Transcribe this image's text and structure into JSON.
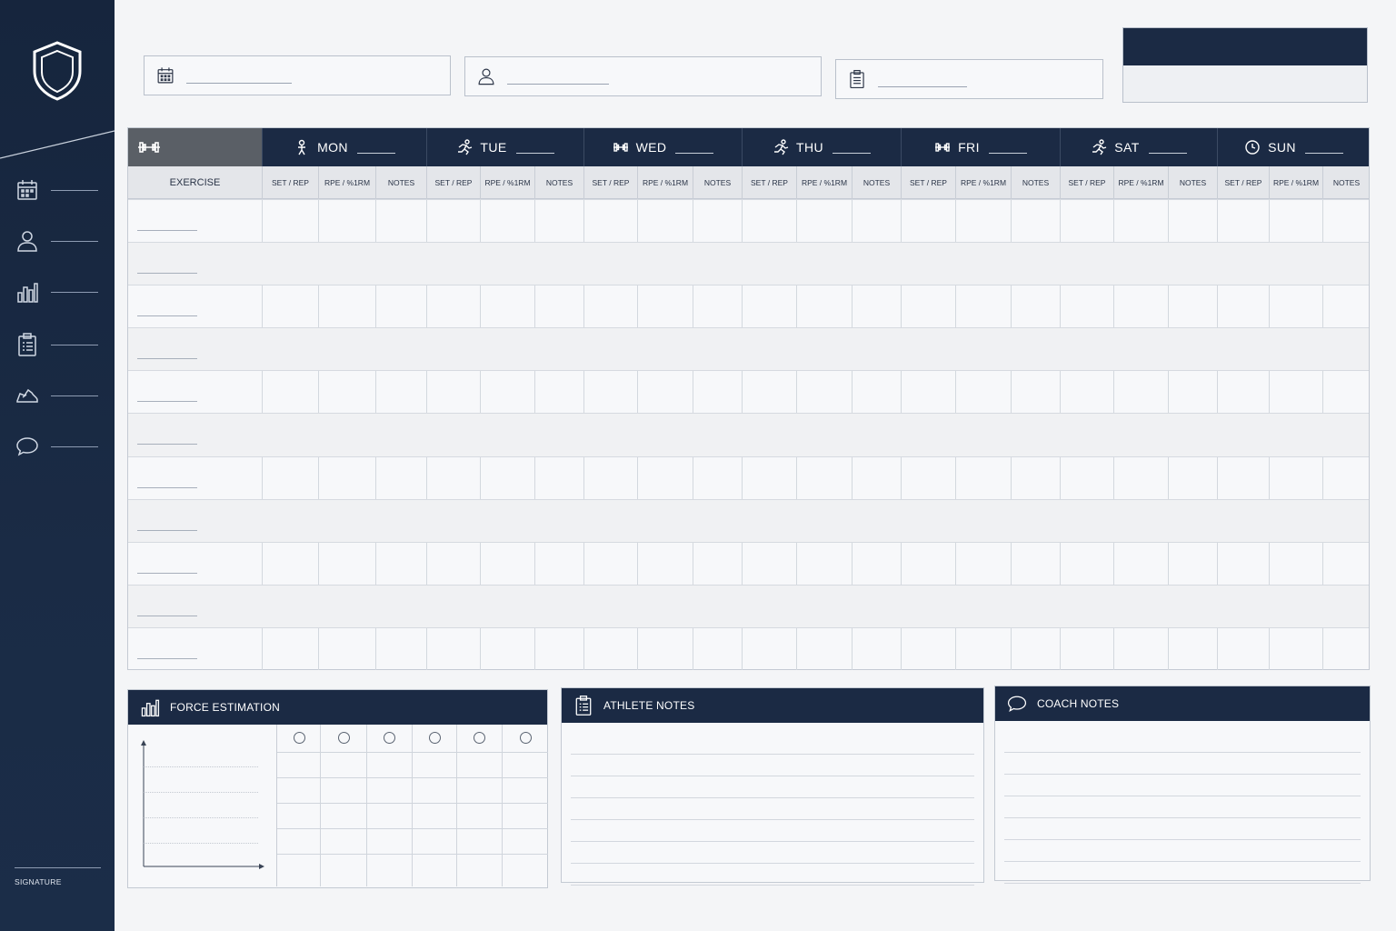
{
  "sidebar": {
    "logo_icon": "shield-icon",
    "items": [
      {
        "icon": "calendar-icon"
      },
      {
        "icon": "user-icon"
      },
      {
        "icon": "bar-chart-icon"
      },
      {
        "icon": "clipboard-icon"
      },
      {
        "icon": "sneaker-icon"
      },
      {
        "icon": "chat-bubble-icon"
      }
    ],
    "signature_label": "SIGNATURE"
  },
  "top_fields": [
    {
      "icon": "calendar-icon"
    },
    {
      "icon": "user-icon"
    },
    {
      "icon": "clipboard-icon"
    }
  ],
  "table": {
    "first_header_icon": "dumbbell-icon",
    "exercise_label": "EXERCISE",
    "days": [
      {
        "label": "MON",
        "icon": "figure-icon"
      },
      {
        "label": "TUE",
        "icon": "runner-icon"
      },
      {
        "label": "WED",
        "icon": "dumbbell-icon"
      },
      {
        "label": "THU",
        "icon": "runner-icon"
      },
      {
        "label": "FRI",
        "icon": "dumbbell-icon"
      },
      {
        "label": "SAT",
        "icon": "runner-icon"
      },
      {
        "label": "SUN",
        "icon": "clock-icon"
      }
    ],
    "sub_headers": [
      "SET / REP",
      "RPE / %1RM",
      "NOTES"
    ],
    "row_count": 11
  },
  "panels": {
    "force": {
      "title": "FORCE ESTIMATION",
      "icon": "bar-chart-icon"
    },
    "athlete": {
      "title": "ATHLETE NOTES",
      "icon": "clipboard-icon"
    },
    "coach": {
      "title": "COACH NOTES",
      "icon": "chat-bubble-icon"
    }
  },
  "colors": {
    "navy": "#1b2a44",
    "header_gray": "#5a5f66",
    "paper": "#f7f8fa"
  }
}
